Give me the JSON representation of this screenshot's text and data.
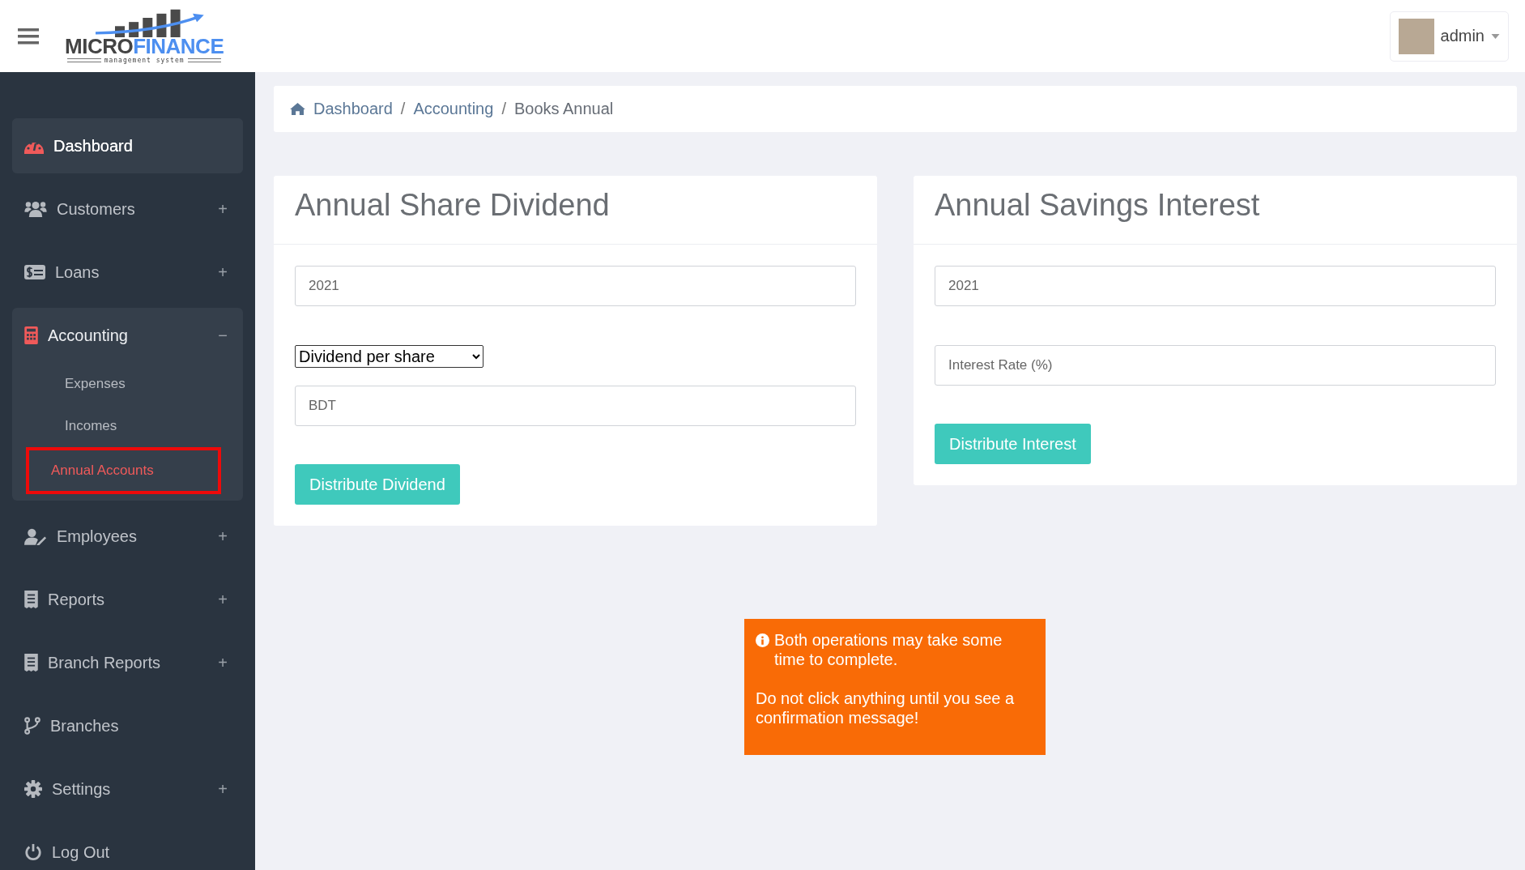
{
  "header": {
    "logo": {
      "word_1": "MICRO",
      "word_2": "FINANCE",
      "tagline": "management system"
    },
    "user": {
      "name": "admin"
    }
  },
  "sidebar": {
    "items": [
      {
        "label": "Dashboard",
        "selected": true
      },
      {
        "label": "Customers",
        "selected": false,
        "toggle": "+",
        "expanded": false
      },
      {
        "label": "Loans",
        "selected": false,
        "toggle": "+",
        "expanded": false
      },
      {
        "label": "Accounting",
        "selected": false,
        "toggle": "−",
        "expanded": true,
        "children": [
          {
            "label": "Expenses",
            "selected": false
          },
          {
            "label": "Incomes",
            "selected": false
          },
          {
            "label": "Annual Accounts",
            "selected": true
          }
        ]
      },
      {
        "label": "Employees",
        "selected": false,
        "toggle": "+",
        "expanded": false
      },
      {
        "label": "Reports",
        "selected": false,
        "toggle": "+",
        "expanded": false
      },
      {
        "label": "Branch Reports",
        "selected": false,
        "toggle": "+",
        "expanded": false
      },
      {
        "label": "Branches",
        "selected": false
      },
      {
        "label": "Settings",
        "selected": false,
        "toggle": "+",
        "expanded": false
      },
      {
        "label": "Log Out",
        "selected": false
      }
    ]
  },
  "breadcrumb": [
    {
      "label": "Dashboard",
      "current": false
    },
    {
      "label": "Accounting",
      "current": false
    },
    {
      "label": "Books Annual",
      "current": true
    }
  ],
  "breadcrumb_separator": "/",
  "cards": [
    {
      "title": "Annual Share Dividend",
      "fields": [
        {
          "kind": "input",
          "placeholder": "2021"
        },
        {
          "kind": "select",
          "value": "Dividend per share"
        },
        {
          "kind": "input",
          "placeholder": "BDT"
        }
      ],
      "button": "Distribute Dividend"
    },
    {
      "title": "Annual Savings Interest",
      "fields": [
        {
          "kind": "input",
          "placeholder": "2021"
        },
        {
          "kind": "input",
          "placeholder": "Interest Rate (%)"
        }
      ],
      "button": "Distribute Interest"
    }
  ],
  "alert": {
    "lines": [
      "Both operations may take some time to complete.",
      "Do not click anything until you see a confirmation message!"
    ]
  }
}
